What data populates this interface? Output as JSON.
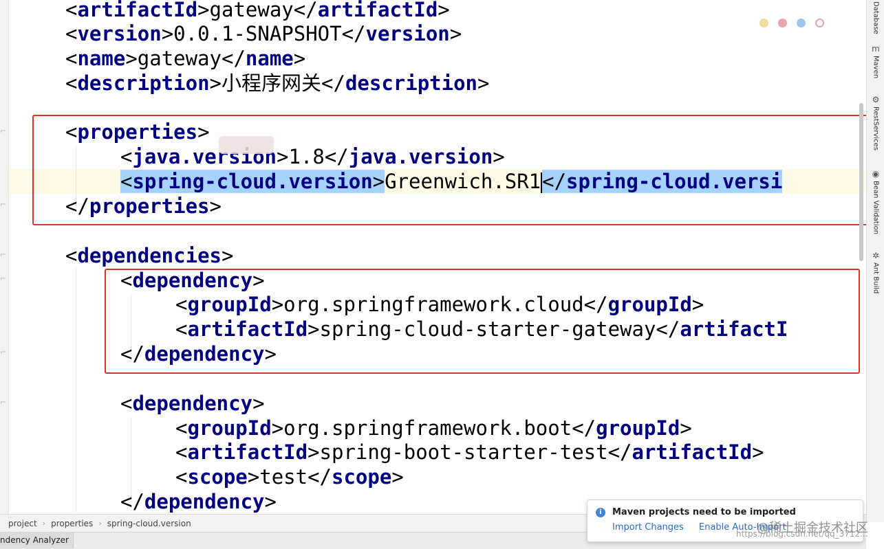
{
  "editor": {
    "lines": [
      {
        "open": "artifactId",
        "text": "gateway",
        "close": "artifactId"
      },
      {
        "open": "version",
        "text": "0.0.1-SNAPSHOT",
        "close": "version"
      },
      {
        "open": "name",
        "text": "gateway",
        "close": "name"
      },
      {
        "open": "description",
        "text": "小程序网关",
        "close": "description"
      },
      {
        "open": "properties"
      },
      {
        "open": "java.version",
        "text": "1.8",
        "close": "java.version"
      },
      {
        "open": "spring-cloud.version",
        "text": "Greenwich.SR1",
        "close": "spring-cloud.versi"
      },
      {
        "close": "properties"
      },
      {
        "open": "dependencies"
      },
      {
        "open": "dependency"
      },
      {
        "open": "groupId",
        "text": "org.springframework.cloud",
        "close": "groupId"
      },
      {
        "open": "artifactId",
        "text": "spring-cloud-starter-gateway",
        "close": "artifactI"
      },
      {
        "close": "dependency"
      },
      {
        "open": "dependency"
      },
      {
        "open": "groupId",
        "text": "org.springframework.boot",
        "close": "groupId"
      },
      {
        "open": "artifactId",
        "text": "spring-boot-starter-test",
        "close": "artifactId"
      },
      {
        "open": "scope",
        "text": "test",
        "close": "scope"
      },
      {
        "close": "dependency"
      }
    ]
  },
  "breadcrumb": [
    "project",
    "properties",
    "spring-cloud.version"
  ],
  "bottom_tab": "ndency Analyzer",
  "right_toolbar": [
    {
      "label": "Database",
      "icon": "database-icon"
    },
    {
      "label": "Maven",
      "icon": "maven-icon",
      "glyph": "m"
    },
    {
      "label": "RestServices",
      "icon": "rest-services-icon",
      "glyph": "⚙"
    },
    {
      "label": "Bean Validation",
      "icon": "bean-validation-icon",
      "glyph": "◉"
    },
    {
      "label": "Ant Build",
      "icon": "ant-build-icon",
      "glyph": "✲"
    }
  ],
  "notification": {
    "title": "Maven projects need to be imported",
    "import_changes": "Import Changes",
    "enable_auto_import": "Enable Auto-Import"
  },
  "watermark": {
    "main": "@稀土掘金技术社区",
    "url": "https://blog.csdn.net/qq_3712..."
  },
  "colors": {
    "tag": "#000080",
    "selection": "#a6d2ff",
    "annotation_box": "#d9342b",
    "link": "#2a6cc9"
  }
}
